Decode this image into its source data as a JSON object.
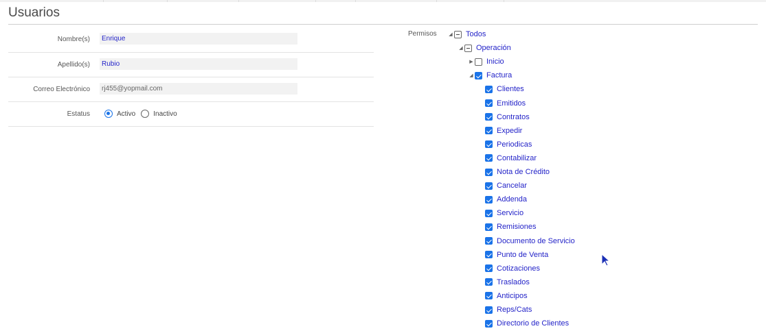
{
  "page": {
    "title": "Usuarios"
  },
  "form": {
    "nombre": {
      "label": "Nombre(s)",
      "value": "Enrique"
    },
    "apellido": {
      "label": "Apellido(s)",
      "value": "Rubio"
    },
    "correo": {
      "label": "Correo Electrónico",
      "value": "rj455@yopmail.com"
    },
    "estatus": {
      "label": "Estatus",
      "options": [
        "Activo",
        "Inactivo"
      ],
      "selected": "Activo"
    }
  },
  "permisos": {
    "label": "Permisos",
    "tree": [
      {
        "label": "Todos",
        "state": "partial",
        "expander": "expanded"
      },
      {
        "label": "Operación",
        "state": "partial",
        "expander": "expanded"
      },
      {
        "label": "Inicio",
        "state": "unchecked",
        "expander": "collapsed"
      },
      {
        "label": "Factura",
        "state": "checked",
        "expander": "expanded"
      },
      {
        "label": "Clientes",
        "state": "checked"
      },
      {
        "label": "Emitidos",
        "state": "checked"
      },
      {
        "label": "Contratos",
        "state": "checked"
      },
      {
        "label": "Expedir",
        "state": "checked"
      },
      {
        "label": "Periodicas",
        "state": "checked"
      },
      {
        "label": "Contabilizar",
        "state": "checked"
      },
      {
        "label": "Nota de Crédito",
        "state": "checked"
      },
      {
        "label": "Cancelar",
        "state": "checked"
      },
      {
        "label": "Addenda",
        "state": "checked"
      },
      {
        "label": "Servicio",
        "state": "checked"
      },
      {
        "label": "Remisiones",
        "state": "checked"
      },
      {
        "label": "Documento de Servicio",
        "state": "checked"
      },
      {
        "label": "Punto de Venta",
        "state": "checked"
      },
      {
        "label": "Cotizaciones",
        "state": "checked"
      },
      {
        "label": "Traslados",
        "state": "checked"
      },
      {
        "label": "Anticipos",
        "state": "checked"
      },
      {
        "label": "Reps/Cats",
        "state": "checked"
      },
      {
        "label": "Directorio de Clientes",
        "state": "checked"
      }
    ]
  },
  "colors": {
    "accent": "#1a73e8",
    "link": "#2323c8"
  }
}
